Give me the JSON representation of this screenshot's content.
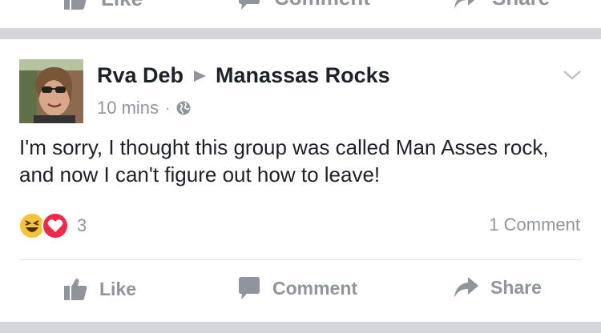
{
  "previous_post": {
    "like_label": "Like",
    "comment_label": "Comment",
    "share_label": "Share"
  },
  "post": {
    "author": "Rva Deb",
    "group": "Manassas Rocks",
    "time": "10 mins",
    "separator": "·",
    "privacy_icon": "globe-icon",
    "text": "I'm sorry, I thought this group was called Man Asses rock, and now I can't figure out how to leave!",
    "reactions": {
      "icons": [
        "haha-reaction-icon",
        "love-reaction-icon"
      ],
      "count": "3"
    },
    "comment_count": "1 Comment"
  },
  "actions": {
    "like_label": "Like",
    "comment_label": "Comment",
    "share_label": "Share"
  },
  "colors": {
    "text": "#1d2129",
    "muted": "#90949c",
    "separator_bar": "#d3d5d9",
    "love": "#f0284a",
    "haha": "#f7c33a"
  }
}
